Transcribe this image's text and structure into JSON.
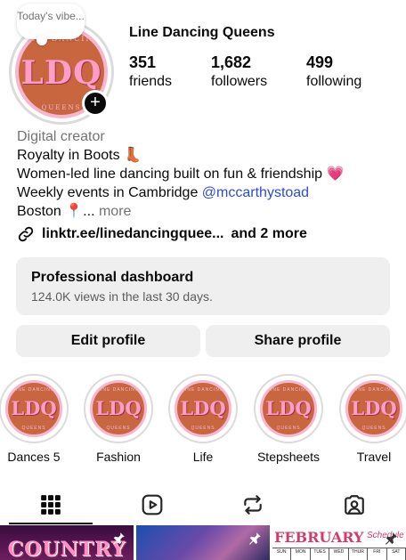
{
  "profile": {
    "note": "Today's vibe...",
    "name": "Line Dancing Queens",
    "avatar": {
      "monogram": "LDQ",
      "arc_top": "LINE DANCING",
      "arc_bottom": "QUEENS"
    },
    "stats": [
      {
        "value": "351",
        "label": "friends"
      },
      {
        "value": "1,682",
        "label": "followers"
      },
      {
        "value": "499",
        "label": "following"
      }
    ]
  },
  "bio": {
    "category": "Digital creator",
    "line1": "Royalty in Boots 👢",
    "line2": "Women-led line dancing built on fun & friendship 💗",
    "line3_text": "Weekly events in Cambridge ",
    "line3_mention": "@mccarthystoad",
    "line4_text": "Boston 📍... ",
    "more": "more",
    "link_text": "linktr.ee/linedancingquee...",
    "link_extra": "and 2 more"
  },
  "dashboard": {
    "title": "Professional dashboard",
    "subtitle": "124.0K views in the last 30 days."
  },
  "actions": {
    "edit_label": "Edit profile",
    "share_label": "Share profile"
  },
  "highlights": [
    {
      "label": "Dances 5"
    },
    {
      "label": "Fashion"
    },
    {
      "label": "Life"
    },
    {
      "label": "Stepsheets"
    },
    {
      "label": "Travel"
    }
  ],
  "tabs": [
    {
      "icon": "grid-icon",
      "active": true
    },
    {
      "icon": "reels-icon",
      "active": false
    },
    {
      "icon": "reposts-icon",
      "active": false
    },
    {
      "icon": "tagged-icon",
      "active": false
    }
  ],
  "grid": {
    "post1_title": "COUNTRY",
    "post3_title": "FEBRUARY",
    "post3_subtitle": "Schedule",
    "post3_days": [
      "SUN",
      "MON",
      "TUES",
      "WED",
      "THUR",
      "FRI",
      "SAT"
    ]
  },
  "colors": {
    "accent_link": "#2b4bd8",
    "button_bg": "#efefef",
    "brand_orange": "#c8663f",
    "brand_pink": "#f7b6cf"
  }
}
